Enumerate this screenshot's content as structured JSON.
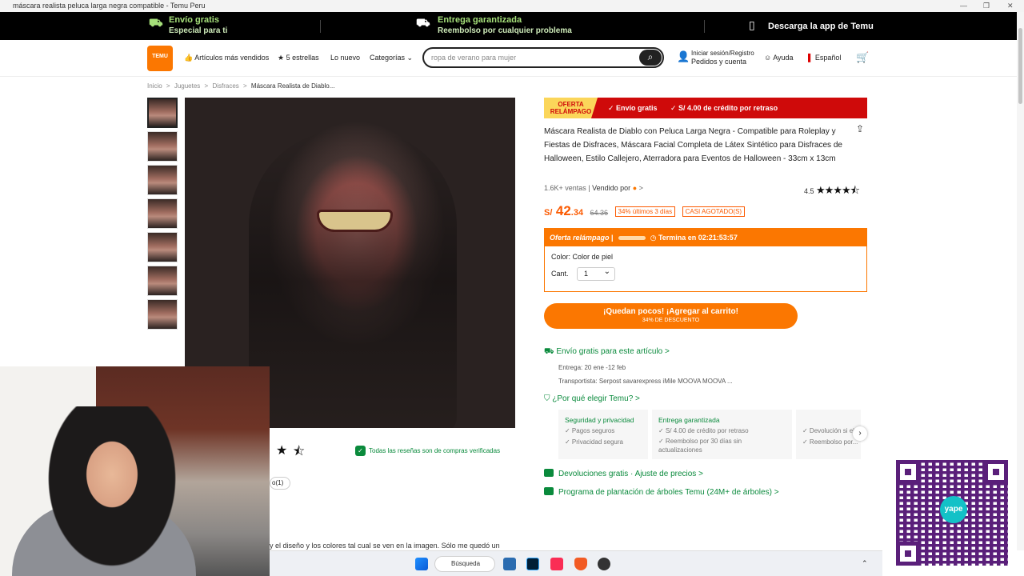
{
  "window": {
    "title": "máscara realista peluca larga negra compatible - Temu Peru"
  },
  "promo": {
    "envio_title": "Envío gratis",
    "envio_sub": "Especial para ti",
    "entrega_title": "Entrega garantizada",
    "entrega_sub": "Reembolso por cualquier problema",
    "app": "Descarga la app de Temu"
  },
  "nav": {
    "logo": "TEMU",
    "links": [
      "Artículos más vendidos",
      "5 estrellas",
      "Lo nuevo",
      "Categorías"
    ],
    "search_placeholder": "ropa de verano para mujer",
    "signin_top": "Iniciar sesión/Registro",
    "signin_bottom": "Pedidos y cuenta",
    "help": "Ayuda",
    "language": "Español"
  },
  "breadcrumb": [
    "Inicio",
    ">",
    "Juguetes",
    ">",
    "Disfraces",
    ">",
    "Máscara Realista de Diablo..."
  ],
  "banner": {
    "flash": "OFERTA RELÁMPAGO",
    "b1": "✓ Envío gratis",
    "b2": "✓ S/ 4.00 de crédito por retraso"
  },
  "product": {
    "title": "Máscara Realista de Diablo con Peluca Larga Negra - Compatible para Roleplay y Fiestas de Disfraces, Máscara Facial Completa de Látex Sintético para Disfraces de Halloween, Estilo Callejero, Aterradora para Eventos de Halloween - 33cm x 13cm",
    "sales": "1.6K+ ventas",
    "sold_by": "Vendido por",
    "rating": "4.5",
    "currency": "S/",
    "price_int": "42",
    "price_dec": ".34",
    "old_price": "64.36",
    "discount_tag": "34% últimos 3 días",
    "stock_tag": "CASI AGOTADO(S)"
  },
  "offer": {
    "label": "Oferta relámpago",
    "ends": "Termina en 02:21:53:57",
    "color_label": "Color: Color de piel",
    "qty_label": "Cant.",
    "qty_value": "1"
  },
  "cart": {
    "label": "¡Quedan pocos! ¡Agregar al carrito!",
    "sub": "34% DE DESCUENTO"
  },
  "shipping": {
    "title": "Envío gratis para este artículo >",
    "delivery": "Entrega: 20 ene -12 feb",
    "carriers": "Transportista: Serpost  savarexpress  iMile  MOOVA  MOOVA ..."
  },
  "why": {
    "title": "¿Por qué elegir Temu? >",
    "cards": [
      {
        "title": "Seguridad y privacidad",
        "items": [
          "✓ Pagos seguros",
          "✓ Privacidad segura"
        ]
      },
      {
        "title": "Entrega garantizada",
        "items": [
          "✓ S/ 4.00 de crédito por retraso",
          "✓ Reembolso por 30 días sin actualizaciones"
        ]
      },
      {
        "title": "",
        "items": [
          "✓ Devolución si el...",
          "✓ Reembolso por..."
        ]
      }
    ]
  },
  "links": {
    "returns": "Devoluciones gratis · Ajuste de precios >",
    "trees": "Programa de plantación de árboles Temu (24M+ de árboles) >"
  },
  "reviews": {
    "verified": "Todas las reseñas son de compras verificadas",
    "pill": "o(1)",
    "text": "y el diseño y los colores tal cual se ven en la imagen. Sólo me quedó un"
  },
  "taskbar": {
    "search": "Búsqueda"
  },
  "qr": {
    "brand": "yape"
  }
}
